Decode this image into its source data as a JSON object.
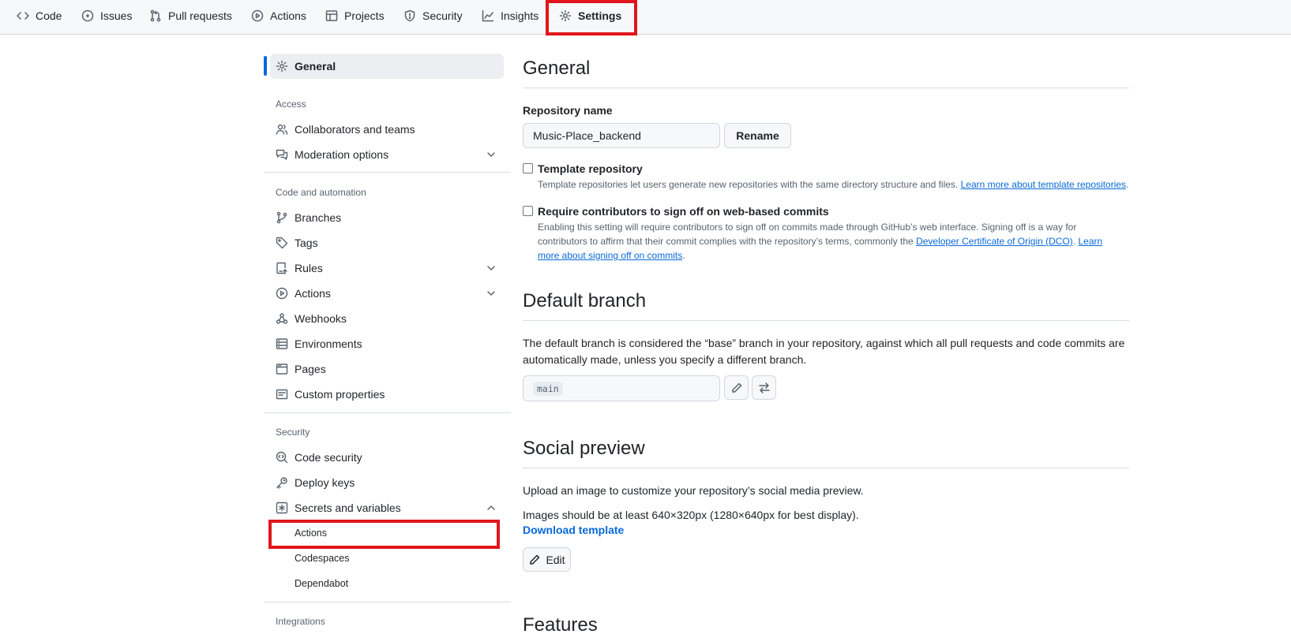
{
  "repo_nav": {
    "tabs": [
      {
        "label": "Code",
        "icon": "code-icon"
      },
      {
        "label": "Issues",
        "icon": "issue-icon"
      },
      {
        "label": "Pull requests",
        "icon": "pull-request-icon"
      },
      {
        "label": "Actions",
        "icon": "play-icon"
      },
      {
        "label": "Projects",
        "icon": "table-icon"
      },
      {
        "label": "Security",
        "icon": "shield-icon"
      },
      {
        "label": "Insights",
        "icon": "graph-icon"
      },
      {
        "label": "Settings",
        "icon": "gear-icon"
      }
    ],
    "active_tab": "Settings"
  },
  "sidebar": {
    "general": "General",
    "access_heading": "Access",
    "collaborators": "Collaborators and teams",
    "moderation": "Moderation options",
    "code_automation_heading": "Code and automation",
    "branches": "Branches",
    "tags": "Tags",
    "rules": "Rules",
    "actions": "Actions",
    "webhooks": "Webhooks",
    "environments": "Environments",
    "pages": "Pages",
    "custom_properties": "Custom properties",
    "security_heading": "Security",
    "code_security": "Code security",
    "deploy_keys": "Deploy keys",
    "secrets_variables": "Secrets and variables",
    "secrets_actions": "Actions",
    "secrets_codespaces": "Codespaces",
    "secrets_dependabot": "Dependabot",
    "integrations_heading": "Integrations"
  },
  "general": {
    "title": "General",
    "repo_name_label": "Repository name",
    "repo_name_value": "Music-Place_backend",
    "rename_button": "Rename",
    "template_title": "Template repository",
    "template_note": "Template repositories let users generate new repositories with the same directory structure and files.",
    "template_link": "Learn more about template repositories",
    "signoff_title": "Require contributors to sign off on web-based commits",
    "signoff_note_1": "Enabling this setting will require contributors to sign off on commits made through GitHub’s web interface. Signing off is a way for",
    "signoff_note_2": "contributors to affirm that their commit complies with the repository’s terms, commonly the",
    "signoff_link_dco": "Developer Certificate of Origin (DCO)",
    "signoff_link_learn_a": "Learn",
    "signoff_link_learn_b": "more about signing off on commits"
  },
  "default_branch": {
    "title": "Default branch",
    "desc_1": "The default branch is considered the “base” branch in your repository, against which all pull requests and code commits are",
    "desc_2": "automatically made, unless you specify a different branch.",
    "branch": "main"
  },
  "social_preview": {
    "title": "Social preview",
    "desc": "Upload an image to customize your repository’s social media preview.",
    "size_note": "Images should be at least 640×320px (1280×640px for best display).",
    "download": "Download template",
    "edit": "Edit"
  },
  "features": {
    "title": "Features"
  },
  "colors": {
    "accent": "#0969da",
    "highlight": "#e0161b"
  }
}
